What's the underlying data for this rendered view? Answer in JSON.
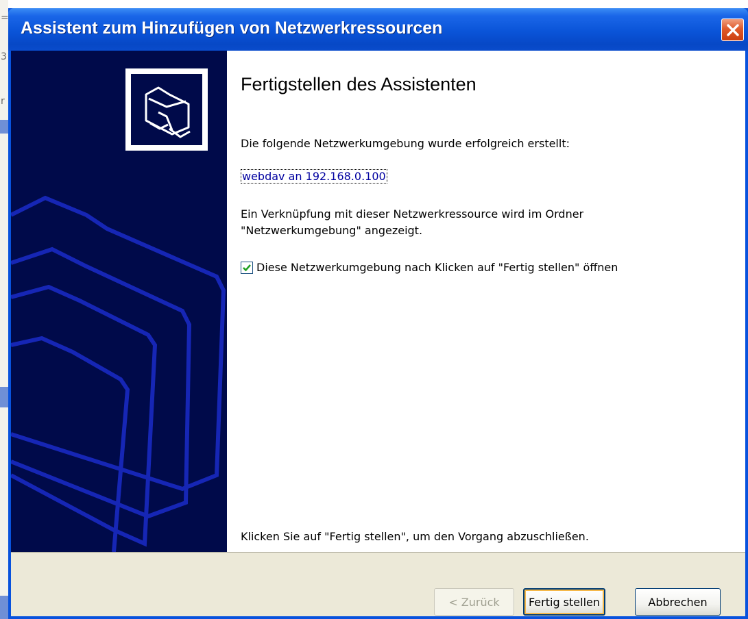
{
  "window": {
    "title": "Assistent zum Hinzufügen von Netzwerkressourcen"
  },
  "content": {
    "heading": "Fertigstellen des Assistenten",
    "intro": "Die folgende Netzwerkumgebung wurde erfolgreich erstellt:",
    "link": "webdav an 192.168.0.100",
    "info_line1": "Ein Verknüpfung mit dieser Netzwerkressource wird im Ordner",
    "info_line2": "\"Netzwerkumgebung\" angezeigt.",
    "checkbox_label": "Diese Netzwerkumgebung nach Klicken auf \"Fertig stellen\" öffnen",
    "checkbox_checked": true,
    "footer_hint": "Klicken Sie auf \"Fertig stellen\", um den Vorgang abzuschließen."
  },
  "buttons": {
    "back": "< Zurück",
    "finish": "Fertig stellen",
    "cancel": "Abbrechen"
  },
  "icons": {
    "sidebar": "network-folder-icon",
    "close": "close-icon",
    "check": "check-icon"
  },
  "colors": {
    "title_bar": "#0a54d8",
    "sidebar": "#000a4a",
    "link": "#0000a0",
    "close_button": "#e05a2a",
    "footer": "#ece9d8"
  }
}
